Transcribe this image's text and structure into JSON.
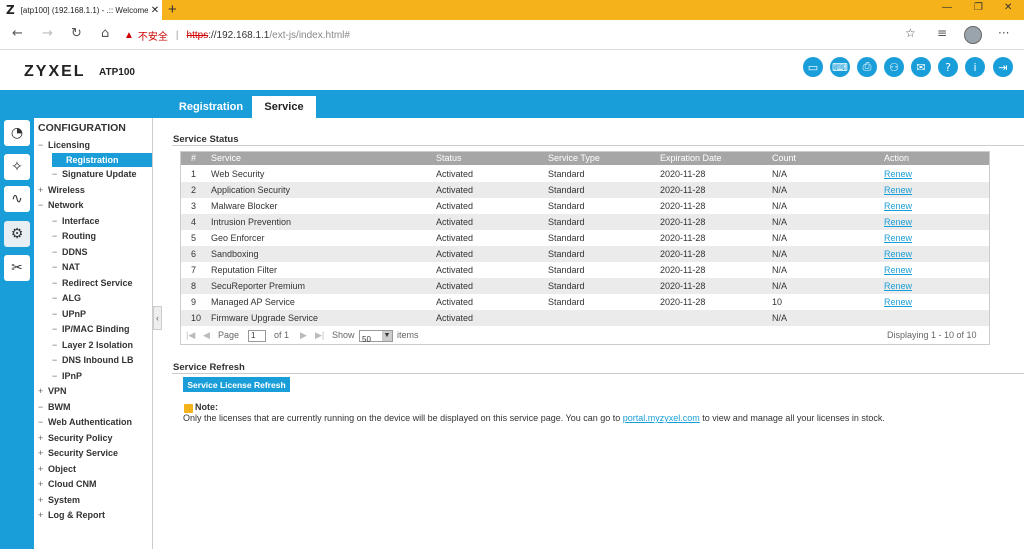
{
  "browser": {
    "tab_title": "[atp100] (192.168.1.1) - .:: Welcome",
    "favicon": "Z",
    "new_tab": "+",
    "security_label": "不安全",
    "url_scheme": "https",
    "url_host": "://192.168.1.1",
    "url_path": "/ext-js/index.html#"
  },
  "header": {
    "brand": "ZYXEL",
    "model": "ATP100",
    "icons": [
      "console-icon",
      "cli-icon",
      "print-icon",
      "sitemap-icon",
      "chat-icon",
      "help-icon",
      "info-icon",
      "logout-icon"
    ]
  },
  "tabs": [
    {
      "label": "Registration",
      "active": false
    },
    {
      "label": "Service",
      "active": true
    }
  ],
  "toolbar": [
    "dashboard-icon",
    "wizard-icon",
    "monitor-icon",
    "configuration-icon",
    "maintenance-icon"
  ],
  "sidebar": {
    "title": "CONFIGURATION",
    "items": [
      {
        "label": "Licensing",
        "marker": "−",
        "level": 0
      },
      {
        "label": "Registration",
        "marker": "",
        "level": 1,
        "selected": true
      },
      {
        "label": "Signature Update",
        "marker": "−",
        "level": 1
      },
      {
        "label": "Wireless",
        "marker": "+",
        "level": 0
      },
      {
        "label": "Network",
        "marker": "−",
        "level": 0
      },
      {
        "label": "Interface",
        "marker": "−",
        "level": 1
      },
      {
        "label": "Routing",
        "marker": "−",
        "level": 1
      },
      {
        "label": "DDNS",
        "marker": "−",
        "level": 1
      },
      {
        "label": "NAT",
        "marker": "−",
        "level": 1
      },
      {
        "label": "Redirect Service",
        "marker": "−",
        "level": 1
      },
      {
        "label": "ALG",
        "marker": "−",
        "level": 1
      },
      {
        "label": "UPnP",
        "marker": "−",
        "level": 1
      },
      {
        "label": "IP/MAC Binding",
        "marker": "−",
        "level": 1
      },
      {
        "label": "Layer 2 Isolation",
        "marker": "−",
        "level": 1
      },
      {
        "label": "DNS Inbound LB",
        "marker": "−",
        "level": 1
      },
      {
        "label": "IPnP",
        "marker": "−",
        "level": 1
      },
      {
        "label": "VPN",
        "marker": "+",
        "level": 0
      },
      {
        "label": "BWM",
        "marker": "−",
        "level": 0
      },
      {
        "label": "Web Authentication",
        "marker": "−",
        "level": 0
      },
      {
        "label": "Security Policy",
        "marker": "+",
        "level": 0
      },
      {
        "label": "Security Service",
        "marker": "+",
        "level": 0
      },
      {
        "label": "Object",
        "marker": "+",
        "level": 0
      },
      {
        "label": "Cloud CNM",
        "marker": "+",
        "level": 0
      },
      {
        "label": "System",
        "marker": "+",
        "level": 0
      },
      {
        "label": "Log & Report",
        "marker": "+",
        "level": 0
      }
    ]
  },
  "service_status": {
    "title": "Service Status",
    "columns": [
      "#",
      "Service",
      "Status",
      "Service Type",
      "Expiration Date",
      "Count",
      "Action"
    ],
    "rows": [
      [
        "1",
        "Web Security",
        "Activated",
        "Standard",
        "2020-11-28",
        "N/A",
        "Renew"
      ],
      [
        "2",
        "Application Security",
        "Activated",
        "Standard",
        "2020-11-28",
        "N/A",
        "Renew"
      ],
      [
        "3",
        "Malware Blocker",
        "Activated",
        "Standard",
        "2020-11-28",
        "N/A",
        "Renew"
      ],
      [
        "4",
        "Intrusion Prevention",
        "Activated",
        "Standard",
        "2020-11-28",
        "N/A",
        "Renew"
      ],
      [
        "5",
        "Geo Enforcer",
        "Activated",
        "Standard",
        "2020-11-28",
        "N/A",
        "Renew"
      ],
      [
        "6",
        "Sandboxing",
        "Activated",
        "Standard",
        "2020-11-28",
        "N/A",
        "Renew"
      ],
      [
        "7",
        "Reputation Filter",
        "Activated",
        "Standard",
        "2020-11-28",
        "N/A",
        "Renew"
      ],
      [
        "8",
        "SecuReporter Premium",
        "Activated",
        "Standard",
        "2020-11-28",
        "N/A",
        "Renew"
      ],
      [
        "9",
        "Managed AP Service",
        "Activated",
        "Standard",
        "2020-11-28",
        "10",
        "Renew"
      ],
      [
        "10",
        "Firmware Upgrade Service",
        "Activated",
        "",
        "",
        "N/A",
        ""
      ]
    ],
    "pager": {
      "page_label": "Page",
      "page_value": "1",
      "of_label": "of 1",
      "show_label": "Show",
      "show_value": "50",
      "items_label": "items",
      "displaying": "Displaying 1 - 10 of 10"
    }
  },
  "service_refresh": {
    "title": "Service Refresh",
    "button": "Service License Refresh"
  },
  "note": {
    "title": "Note:",
    "text_before": "Only the licenses that are currently running on the device will be displayed on this service page. You can go to ",
    "link": "portal.myzyxel.com",
    "text_after": " to view and manage all your licenses in stock."
  },
  "colors": {
    "brand_blue": "#1a9ed9",
    "tabbar_orange": "#f5b21b",
    "grid_header": "#a6a6a6"
  }
}
